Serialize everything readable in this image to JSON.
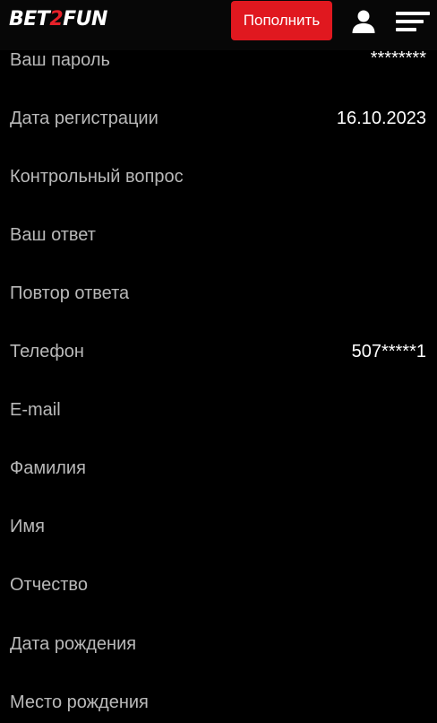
{
  "header": {
    "logo_part1": "BET",
    "logo_part2": "2",
    "logo_part3": "FUN",
    "deposit_label": "Пополнить",
    "user_icon": "user-icon",
    "menu_icon": "menu-icon",
    "colors": {
      "accent": "#e0181f",
      "background": "#000000",
      "label": "#b9b9b9",
      "value": "#ffffff"
    }
  },
  "fields": [
    {
      "label": "Ваш пароль",
      "value": "********"
    },
    {
      "label": "Дата регистрации",
      "value": "16.10.2023"
    },
    {
      "label": "Контрольный вопрос",
      "value": ""
    },
    {
      "label": "Ваш ответ",
      "value": ""
    },
    {
      "label": "Повтор ответа",
      "value": ""
    },
    {
      "label": "Телефон",
      "value": "507*****1"
    },
    {
      "label": "E-mail",
      "value": ""
    },
    {
      "label": "Фамилия",
      "value": ""
    },
    {
      "label": "Имя",
      "value": ""
    },
    {
      "label": "Отчество",
      "value": ""
    },
    {
      "label": "Дата рождения",
      "value": ""
    },
    {
      "label": "Место рождения",
      "value": ""
    }
  ]
}
